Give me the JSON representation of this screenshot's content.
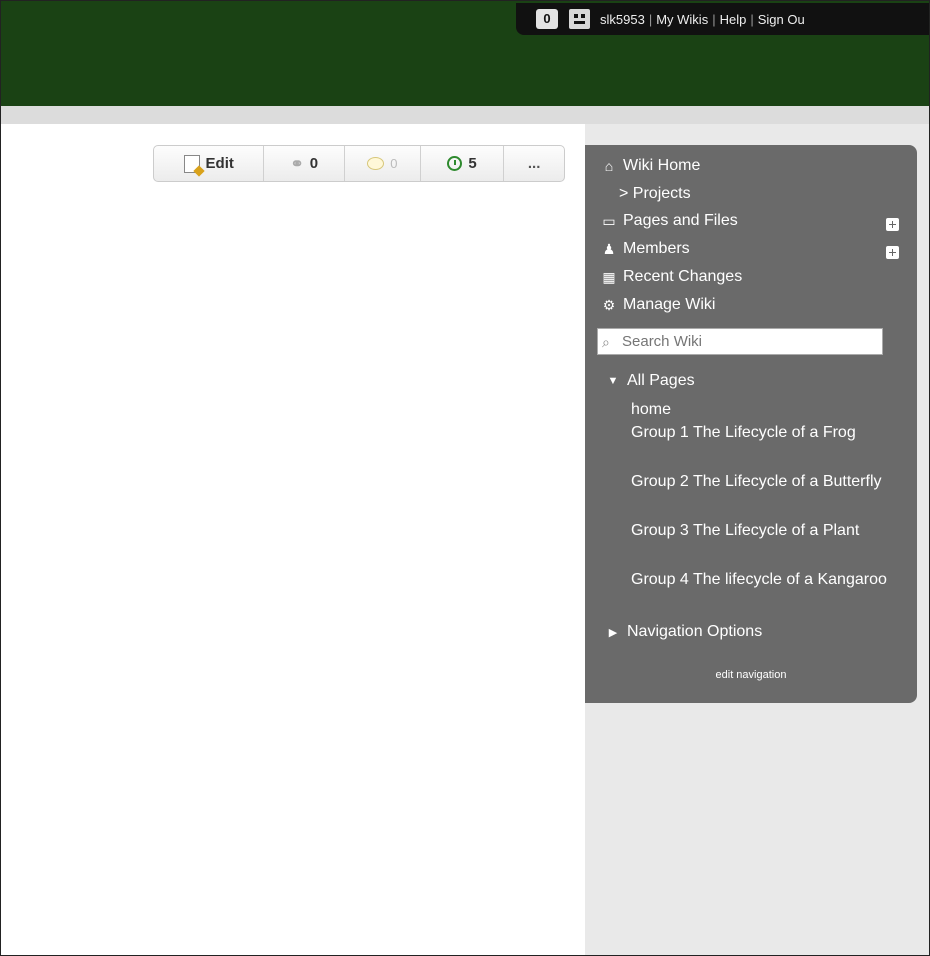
{
  "topbar": {
    "notification_count": "0",
    "username": "slk5953",
    "links": [
      "My Wikis",
      "Help",
      "Sign Ou"
    ]
  },
  "toolbar": {
    "edit_label": "Edit",
    "links_count": "0",
    "comments_count": "0",
    "history_count": "5",
    "more_label": "..."
  },
  "sidebar": {
    "wiki_home": "Wiki Home",
    "projects": "> Projects",
    "pages_and_files": "Pages and Files",
    "members": "Members",
    "recent_changes": "Recent Changes",
    "manage_wiki": "Manage Wiki",
    "search_placeholder": "Search Wiki",
    "all_pages": "All Pages",
    "pages": [
      "home",
      "Group 1 The Lifecycle of a Frog",
      "Group 2 The Lifecycle of a Butterfly",
      "Group 3 The Lifecycle of a Plant",
      "Group 4 The lifecycle of a Kangaroo"
    ],
    "navigation_options": "Navigation Options",
    "edit_navigation": "edit navigation"
  },
  "icons": {
    "wiki_home": "home-icon",
    "pages_and_files": "folder-icon",
    "members": "members-icon",
    "recent_changes": "calendar-icon",
    "manage_wiki": "gear-icon",
    "search": "search-icon"
  },
  "colors": {
    "header": "#1a4214",
    "sidebar": "#6a6a6a",
    "history_green": "#2e8a2e"
  }
}
